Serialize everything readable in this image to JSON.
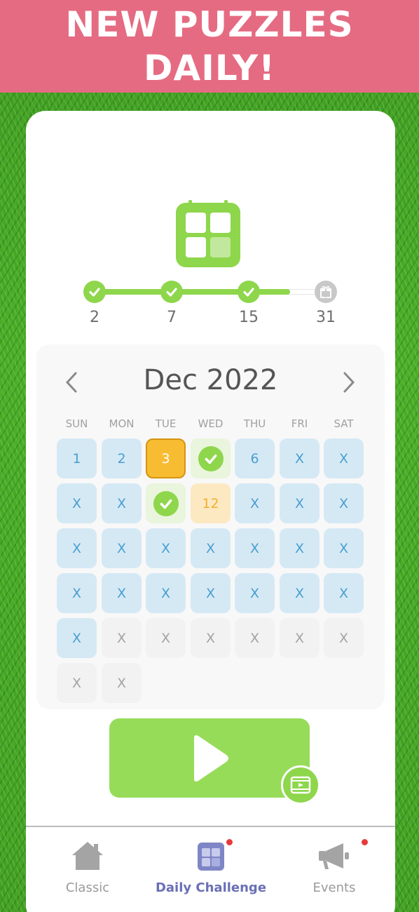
{
  "banner": {
    "line1": "NEW PUZZLES",
    "line2": "DAILY!"
  },
  "header_icon": "daily-calendar-icon",
  "progress": {
    "fill_fraction": 0.85,
    "milestones": [
      {
        "label": "2",
        "state": "done"
      },
      {
        "label": "7",
        "state": "done"
      },
      {
        "label": "15",
        "state": "done"
      },
      {
        "label": "31",
        "state": "gift"
      }
    ]
  },
  "calendar": {
    "month": "Dec 2022",
    "weekdays": [
      "SUN",
      "MON",
      "TUE",
      "WED",
      "THU",
      "FRI",
      "SAT"
    ],
    "days": [
      {
        "text": "1",
        "state": "past"
      },
      {
        "text": "2",
        "state": "past"
      },
      {
        "text": "3",
        "state": "today"
      },
      {
        "text": "",
        "state": "done"
      },
      {
        "text": "6",
        "state": "past"
      },
      {
        "text": "X",
        "state": "past"
      },
      {
        "text": "X",
        "state": "past"
      },
      {
        "text": "X",
        "state": "past"
      },
      {
        "text": "X",
        "state": "past"
      },
      {
        "text": "",
        "state": "done"
      },
      {
        "text": "12",
        "state": "pending"
      },
      {
        "text": "X",
        "state": "past"
      },
      {
        "text": "X",
        "state": "past"
      },
      {
        "text": "X",
        "state": "past"
      },
      {
        "text": "X",
        "state": "past"
      },
      {
        "text": "X",
        "state": "past"
      },
      {
        "text": "X",
        "state": "past"
      },
      {
        "text": "X",
        "state": "past"
      },
      {
        "text": "X",
        "state": "past"
      },
      {
        "text": "X",
        "state": "past"
      },
      {
        "text": "X",
        "state": "past"
      },
      {
        "text": "X",
        "state": "past"
      },
      {
        "text": "X",
        "state": "past"
      },
      {
        "text": "X",
        "state": "past"
      },
      {
        "text": "X",
        "state": "past"
      },
      {
        "text": "X",
        "state": "past"
      },
      {
        "text": "X",
        "state": "past"
      },
      {
        "text": "X",
        "state": "past"
      },
      {
        "text": "X",
        "state": "past"
      },
      {
        "text": "X",
        "state": "future"
      },
      {
        "text": "X",
        "state": "future"
      },
      {
        "text": "X",
        "state": "future"
      },
      {
        "text": "X",
        "state": "future"
      },
      {
        "text": "X",
        "state": "future"
      },
      {
        "text": "X",
        "state": "future"
      },
      {
        "text": "X",
        "state": "future"
      },
      {
        "text": "X",
        "state": "future"
      }
    ]
  },
  "play": {
    "icon": "play-icon",
    "badge_icon": "video-ad-icon"
  },
  "tabs": [
    {
      "label": "Classic",
      "icon": "house-icon",
      "active": false,
      "badge": false
    },
    {
      "label": "Daily Challenge",
      "icon": "calendar-icon",
      "active": true,
      "badge": true
    },
    {
      "label": "Events",
      "icon": "megaphone-icon",
      "active": false,
      "badge": true
    }
  ],
  "colors": {
    "banner": "#e56b82",
    "accent_green": "#8ed64b",
    "today": "#f8bc33",
    "past_day": "#d5e9f5",
    "active_tab": "#6a6fb5"
  }
}
